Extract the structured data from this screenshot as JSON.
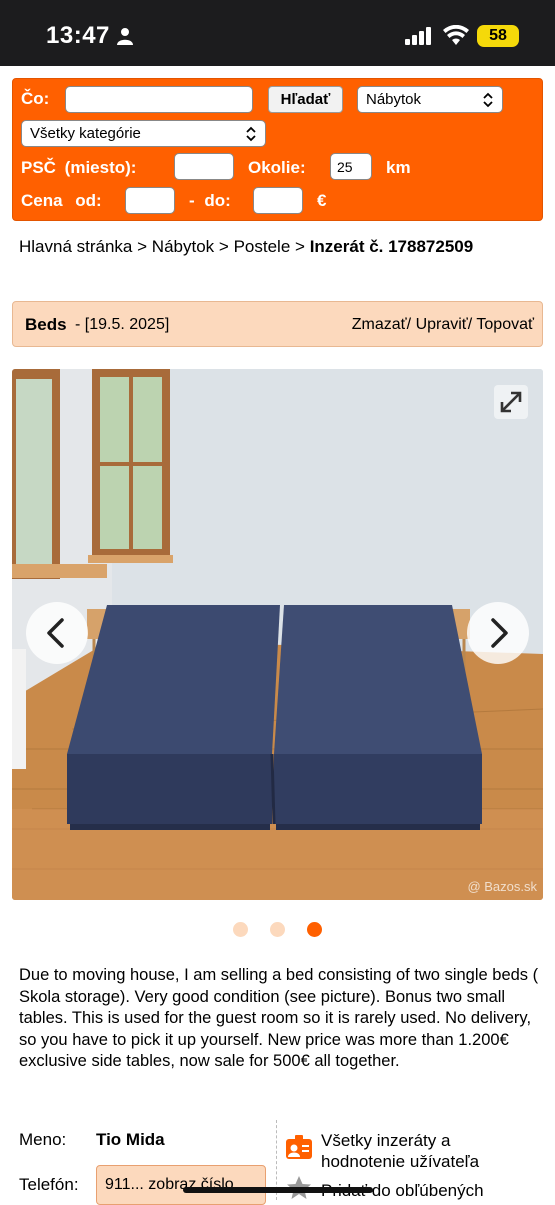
{
  "status_bar": {
    "time": "13:47",
    "battery": "58"
  },
  "search": {
    "co_label": "Čo:",
    "co_value": "",
    "search_button": "Hľadať",
    "section_select": "Nábytok",
    "category_select": "Všetky kategórie",
    "psc_label": "PSČ (miesto):",
    "psc_value": "",
    "okolie_label": "Okolie:",
    "okolie_value": "25",
    "km_label": "km",
    "cena_label": "Cena od:",
    "cena_od_value": "",
    "do_label": "- do:",
    "cena_do_value": "",
    "currency": "€"
  },
  "breadcrumb": {
    "home": "Hlavná stránka",
    "category": "Nábytok",
    "subcategory": "Postele",
    "current": "Inzerát č. 178872509",
    "separator": ">"
  },
  "listing": {
    "title": "Beds",
    "date": "- [19.5. 2025]",
    "actions": "Zmazať/ Upraviť/ Topovať",
    "watermark": "@ Bazos.sk",
    "image_count": 3,
    "active_image": 3,
    "description": "Due to moving house, I am selling a bed consisting of two single beds ( Skola storage). Very good condition (see picture). Bonus two small tables. This is used for the guest room so it is rarely used. No delivery, so you have to pick it up yourself. New price was more than 1.200€ exclusive side tables, now sale for 500€ all together."
  },
  "contact": {
    "name_label": "Meno:",
    "name_value": "Tio Mida",
    "phone_label": "Telefón:",
    "phone_value": "911... zobraz číslo",
    "all_ads_link": "Všetky inzeráty a hodnotenie užívateľa",
    "favorite_link": "Pridať do obľúbených"
  },
  "colors": {
    "accent": "#ff6000",
    "header_bg": "#fcd9bd"
  }
}
